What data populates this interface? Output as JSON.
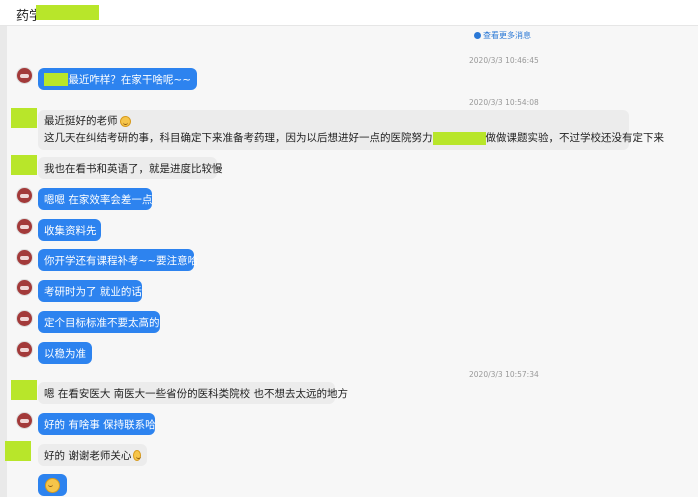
{
  "header": {
    "title": "药学"
  },
  "more_link": "查看更多消息",
  "timestamps": [
    "2020/3/3 10:46:45",
    "2020/3/3 10:54:08",
    "2020/3/3 10:57:34"
  ],
  "messages": {
    "m1": "最近咋样？在家干啥呢~~",
    "m2_line1": "最近挺好的老师",
    "m2_line2a": "这几天在纠结考研的事，科目确定下来准备考药理，因为以后想进好一点的医院努力",
    "m2_line2b": "做做课题实验，不过学校还没有定下来",
    "m3": "我也在看书和英语了，就是进度比较慢",
    "m4": "嗯嗯 在家效率会差一点",
    "m5": "收集资料先",
    "m6": "你开学还有课程补考~~要注意哈",
    "m7": "考研时为了 就业的话",
    "m8": "定个目标标准不要太高的",
    "m9": "以稳为准",
    "m10": "嗯 在看安医大 南医大一些省份的医科类院校 也不想去太远的地方",
    "m11": "好的 有啥事 保持联系哈",
    "m12": "好的 谢谢老师关心"
  },
  "colors": {
    "blue_bubble": "#2d83ef",
    "gray_bubble": "#ececec",
    "redaction": "#b8e62a",
    "link": "#2a78d6"
  }
}
